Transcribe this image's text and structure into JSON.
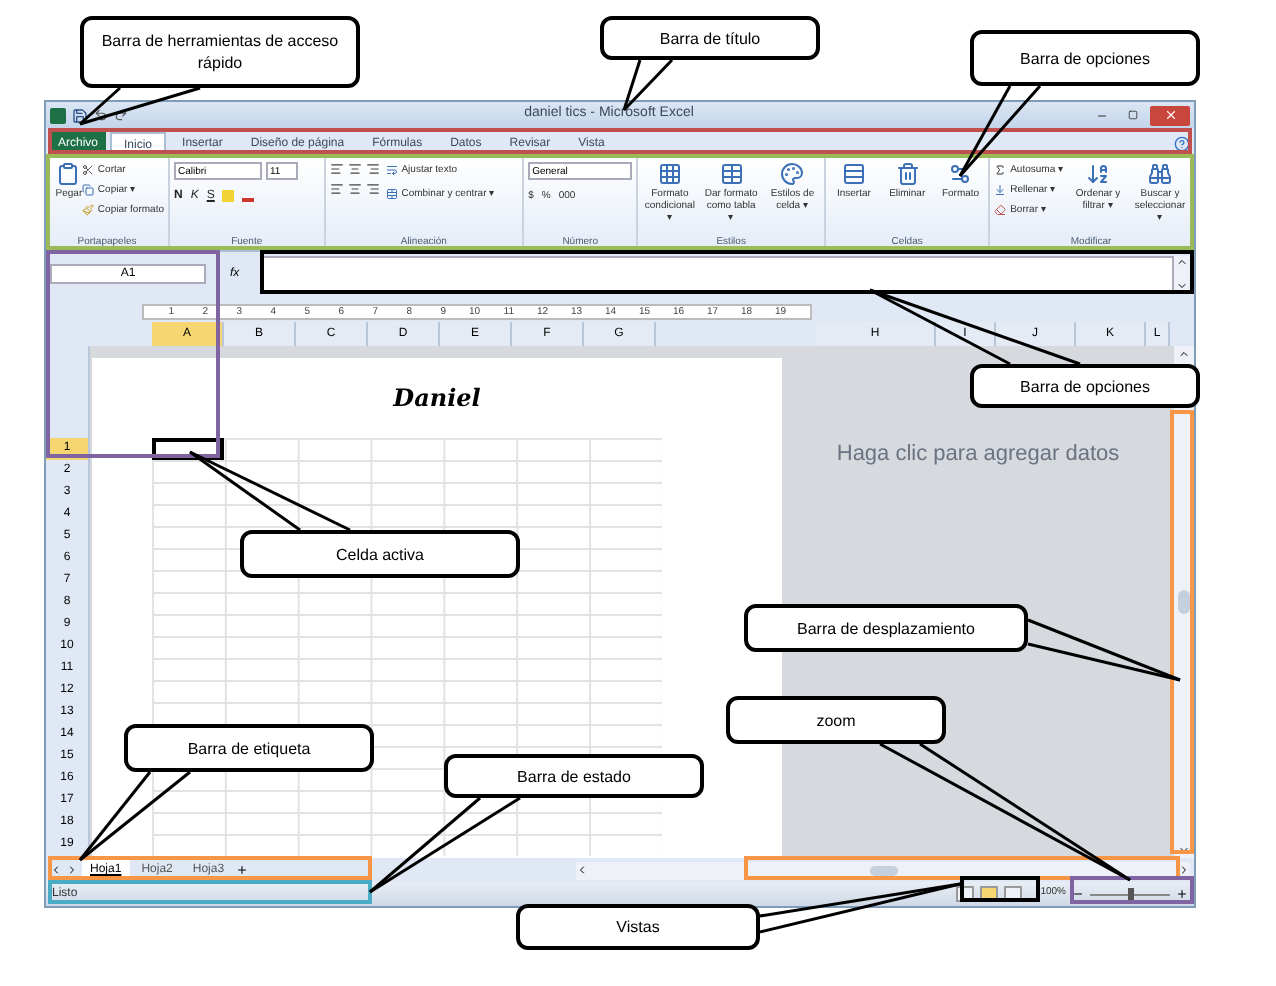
{
  "window": {
    "title": "daniel tics - Microsoft Excel"
  },
  "tabs": [
    {
      "label": "Archivo",
      "kind": "file",
      "selected": false
    },
    {
      "label": "Inicio",
      "kind": "tab",
      "selected": true
    },
    {
      "label": "Insertar",
      "kind": "tab",
      "selected": false
    },
    {
      "label": "Diseño de página",
      "kind": "tab",
      "selected": false
    },
    {
      "label": "Fórmulas",
      "kind": "tab",
      "selected": false
    },
    {
      "label": "Datos",
      "kind": "tab",
      "selected": false
    },
    {
      "label": "Revisar",
      "kind": "tab",
      "selected": false
    },
    {
      "label": "Vista",
      "kind": "tab",
      "selected": false
    }
  ],
  "ribbon": {
    "clipboard": {
      "label": "Portapapeles",
      "paste": "Pegar",
      "items": [
        "Cortar",
        "Copiar ▾",
        "Copiar formato"
      ]
    },
    "font": {
      "label": "Fuente",
      "name": "Calibri",
      "size": "11",
      "styles": [
        "N",
        "K",
        "S"
      ]
    },
    "alignment": {
      "label": "Alineación",
      "items": [
        "Ajustar texto",
        "Combinar y centrar ▾"
      ]
    },
    "number": {
      "label": "Número",
      "format": "General",
      "symbols": [
        "$",
        "%",
        "000"
      ]
    },
    "styles": {
      "label": "Estilos",
      "items": [
        "Formato condicional ▾",
        "Dar formato como tabla ▾",
        "Estilos de celda ▾"
      ]
    },
    "cells": {
      "label": "Celdas",
      "items": [
        "Insertar",
        "Eliminar",
        "Formato"
      ]
    },
    "editing": {
      "label": "Modificar",
      "small": [
        "Autosuma ▾",
        "Rellenar ▾",
        "Borrar ▾"
      ],
      "large": [
        "Ordenar y filtrar ▾",
        "Buscar y seleccionar ▾"
      ]
    }
  },
  "formula_bar": {
    "name_box": "A1",
    "fx": "fx"
  },
  "ruler": [
    "1",
    "2",
    "3",
    "4",
    "5",
    "6",
    "7",
    "8",
    "9",
    "10",
    "11",
    "12",
    "13",
    "14",
    "15",
    "16",
    "17",
    "18",
    "19"
  ],
  "columns": [
    {
      "label": "A",
      "selected": true
    },
    {
      "label": "B",
      "selected": false
    },
    {
      "label": "C",
      "selected": false
    },
    {
      "label": "D",
      "selected": false
    },
    {
      "label": "E",
      "selected": false
    },
    {
      "label": "F",
      "selected": false
    },
    {
      "label": "G",
      "selected": false
    }
  ],
  "columns_right": [
    "H",
    "I",
    "J",
    "K",
    "L"
  ],
  "rows": [
    {
      "label": "1",
      "selected": true
    },
    {
      "label": "2",
      "selected": false
    },
    {
      "label": "3",
      "selected": false
    },
    {
      "label": "4",
      "selected": false
    },
    {
      "label": "5",
      "selected": false
    },
    {
      "label": "6",
      "selected": false
    },
    {
      "label": "7",
      "selected": false
    },
    {
      "label": "8",
      "selected": false
    },
    {
      "label": "9",
      "selected": false
    },
    {
      "label": "10",
      "selected": false
    },
    {
      "label": "11",
      "selected": false
    },
    {
      "label": "12",
      "selected": false
    },
    {
      "label": "13",
      "selected": false
    },
    {
      "label": "14",
      "selected": false
    },
    {
      "label": "15",
      "selected": false
    },
    {
      "label": "16",
      "selected": false
    },
    {
      "label": "17",
      "selected": false
    },
    {
      "label": "18",
      "selected": false
    },
    {
      "label": "19",
      "selected": false
    }
  ],
  "page_header": "Daniel",
  "add_data_hint": "Haga clic para agregar datos",
  "sheet_tabs": [
    {
      "label": "Hoja1",
      "selected": true
    },
    {
      "label": "Hoja2",
      "selected": false
    },
    {
      "label": "Hoja3",
      "selected": false
    }
  ],
  "status_bar": {
    "text": "Listo",
    "zoom": "100%",
    "zoom_slider": {
      "level": 0.5
    },
    "views": [
      {
        "selected": false
      },
      {
        "selected": true
      },
      {
        "selected": false
      }
    ]
  },
  "callouts": [
    {
      "text": "Barra de herramientas de acceso rápido"
    },
    {
      "text": "Barra de título"
    },
    {
      "text": "Barra de opciones"
    },
    {
      "text": "Barra de opciones"
    },
    {
      "text": "Celda activa"
    },
    {
      "text": "Barra de desplazamiento"
    },
    {
      "text": "zoom"
    },
    {
      "text": "Barra de etiqueta"
    },
    {
      "text": "Barra de estado"
    },
    {
      "text": "Vistas"
    }
  ]
}
